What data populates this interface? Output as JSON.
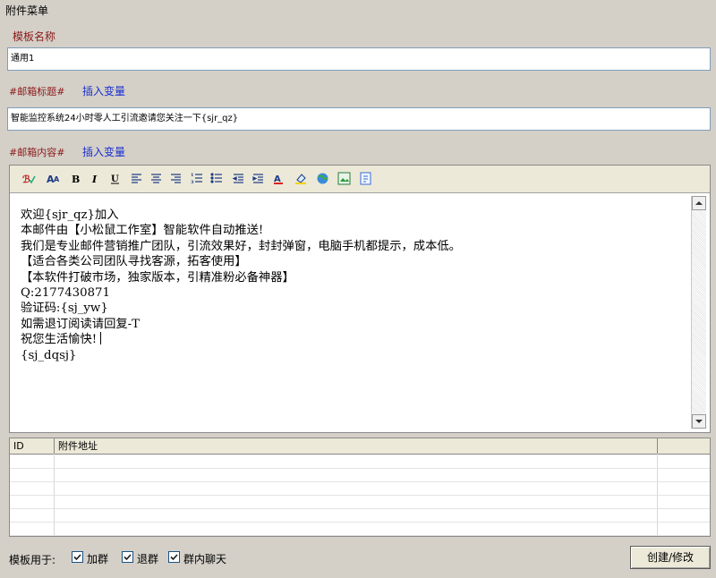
{
  "window": {
    "title": "附件菜单"
  },
  "template_name": {
    "label": "模板名称",
    "value": "通用1"
  },
  "mail_subject": {
    "label": "#邮箱标题#",
    "insert_label": "插入变量",
    "value": "智能监控系统24小时零人工引流邀请您关注一下{sjr_qz}"
  },
  "mail_content": {
    "label": "#邮箱内容#",
    "insert_label": "插入变量",
    "toolbar": {
      "buttons": [
        {
          "name": "spellcheck-icon",
          "text": "ℬ"
        },
        {
          "name": "font-size-icon",
          "text": "A"
        },
        {
          "name": "bold-icon",
          "text": "B"
        },
        {
          "name": "italic-icon",
          "text": "I"
        },
        {
          "name": "underline-icon",
          "text": "U"
        },
        {
          "name": "align-left-icon",
          "text": ""
        },
        {
          "name": "align-center-icon",
          "text": ""
        },
        {
          "name": "align-right-icon",
          "text": ""
        },
        {
          "name": "ordered-list-icon",
          "text": ""
        },
        {
          "name": "unordered-list-icon",
          "text": ""
        },
        {
          "name": "outdent-icon",
          "text": ""
        },
        {
          "name": "indent-icon",
          "text": ""
        },
        {
          "name": "font-color-icon",
          "text": "A"
        },
        {
          "name": "highlight-color-icon",
          "text": ""
        },
        {
          "name": "insert-link-icon",
          "text": ""
        },
        {
          "name": "insert-image-icon",
          "text": ""
        },
        {
          "name": "view-source-icon",
          "text": ""
        }
      ]
    },
    "lines": [
      "欢迎{sjr_qz}加入",
      "本邮件由【小松鼠工作室】智能软件自动推送!",
      "我们是专业邮件营销推广团队，引流效果好，封封弹窗，电脑手机都提示，成本低。",
      "【适合各类公司团队寻找客源，拓客使用】",
      "【本软件打破市场，独家版本，引精准粉必备神器】",
      "Q:2177430871",
      "验证码:{sj_yw}",
      "如需退订阅读请回复-T",
      "祝您生活愉快!",
      "{sj_dqsj}"
    ]
  },
  "attachments": {
    "columns": [
      "ID",
      "附件地址"
    ],
    "rows": []
  },
  "footer": {
    "label": "模板用于:",
    "options": [
      {
        "label": "加群",
        "checked": true
      },
      {
        "label": "退群",
        "checked": true
      },
      {
        "label": "群内聊天",
        "checked": true
      }
    ],
    "create_button": "创建/修改"
  }
}
